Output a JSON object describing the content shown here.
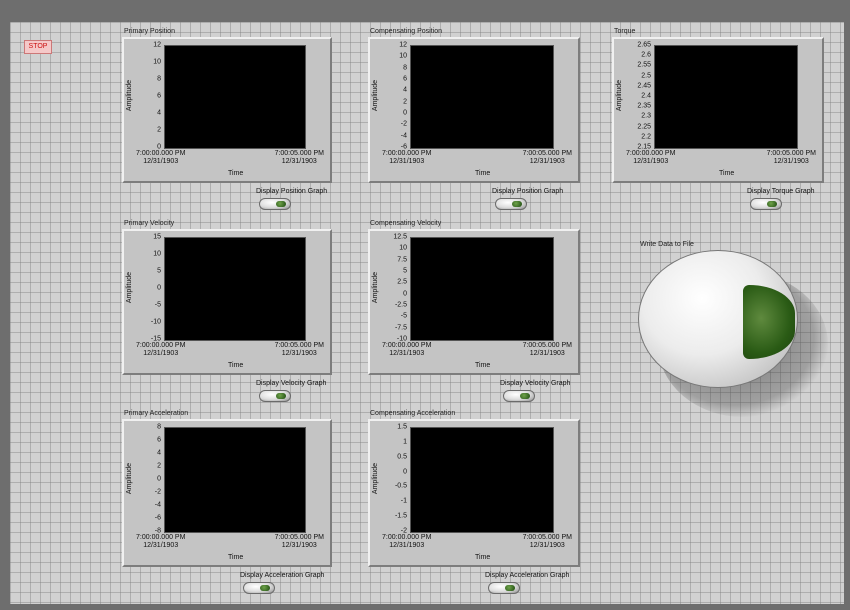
{
  "stop_button": {
    "label": "STOP"
  },
  "graphs": [
    {
      "id": "primary-position",
      "title": "Primary Position",
      "ylabel": "Amplitude",
      "xlabel": "Time",
      "yticks": [
        "12",
        "10",
        "8",
        "6",
        "4",
        "2",
        "0"
      ],
      "x_start": "7:00:00.000 PM",
      "x_start_date": "12/31/1903",
      "x_end": "7:00:05.000 PM",
      "x_end_date": "12/31/1903",
      "toggle_label": "Display Position Graph"
    },
    {
      "id": "compensating-position",
      "title": "Compensating Position",
      "ylabel": "Amplitude",
      "xlabel": "Time",
      "yticks": [
        "12",
        "10",
        "8",
        "6",
        "4",
        "2",
        "0",
        "-2",
        "-4",
        "-6"
      ],
      "x_start": "7:00:00.000 PM",
      "x_start_date": "12/31/1903",
      "x_end": "7:00:05.000 PM",
      "x_end_date": "12/31/1903",
      "toggle_label": "Display Position Graph"
    },
    {
      "id": "torque",
      "title": "Torque",
      "ylabel": "Amplitude",
      "xlabel": "Time",
      "yticks": [
        "2.65",
        "2.6",
        "2.55",
        "2.5",
        "2.45",
        "2.4",
        "2.35",
        "2.3",
        "2.25",
        "2.2",
        "2.15"
      ],
      "x_start": "7:00:00.000 PM",
      "x_start_date": "12/31/1903",
      "x_end": "7:00:05.000 PM",
      "x_end_date": "12/31/1903",
      "toggle_label": "Display Torque Graph"
    },
    {
      "id": "primary-velocity",
      "title": "Primary Velocity",
      "ylabel": "Amplitude",
      "xlabel": "Time",
      "yticks": [
        "15",
        "10",
        "5",
        "0",
        "-5",
        "-10",
        "-15"
      ],
      "x_start": "7:00:00.000 PM",
      "x_start_date": "12/31/1903",
      "x_end": "7:00:05.000 PM",
      "x_end_date": "12/31/1903",
      "toggle_label": "Display Velocity Graph"
    },
    {
      "id": "compensating-velocity",
      "title": "Compensating Velocity",
      "ylabel": "Amplitude",
      "xlabel": "Time",
      "yticks": [
        "12.5",
        "10",
        "7.5",
        "5",
        "2.5",
        "0",
        "-2.5",
        "-5",
        "-7.5",
        "-10"
      ],
      "x_start": "7:00:00.000 PM",
      "x_start_date": "12/31/1903",
      "x_end": "7:00:05.000 PM",
      "x_end_date": "12/31/1903",
      "toggle_label": "Display Velocity Graph"
    },
    {
      "id": "primary-acceleration",
      "title": "Primary Acceleration",
      "ylabel": "Amplitude",
      "xlabel": "Time",
      "yticks": [
        "8",
        "6",
        "4",
        "2",
        "0",
        "-2",
        "-4",
        "-6",
        "-8"
      ],
      "x_start": "7:00:00.000 PM",
      "x_start_date": "12/31/1903",
      "x_end": "7:00:05.000 PM",
      "x_end_date": "12/31/1903",
      "toggle_label": "Display Acceleration Graph"
    },
    {
      "id": "compensating-acceleration",
      "title": "Compensating Acceleration",
      "ylabel": "Amplitude",
      "xlabel": "Time",
      "yticks": [
        "1.5",
        "1",
        "0.5",
        "0",
        "-0.5",
        "-1",
        "-1.5",
        "-2"
      ],
      "x_start": "7:00:00.000 PM",
      "x_start_date": "12/31/1903",
      "x_end": "7:00:05.000 PM",
      "x_end_date": "12/31/1903",
      "toggle_label": "Display Acceleration Graph"
    }
  ],
  "write_button": {
    "label": "Write Data to File",
    "state": "on"
  },
  "colors": {
    "panel_bg": "#d1d1d1",
    "plot_bg": "#000000",
    "led_green": "#2a5b15",
    "stop_text": "#cc1111"
  }
}
